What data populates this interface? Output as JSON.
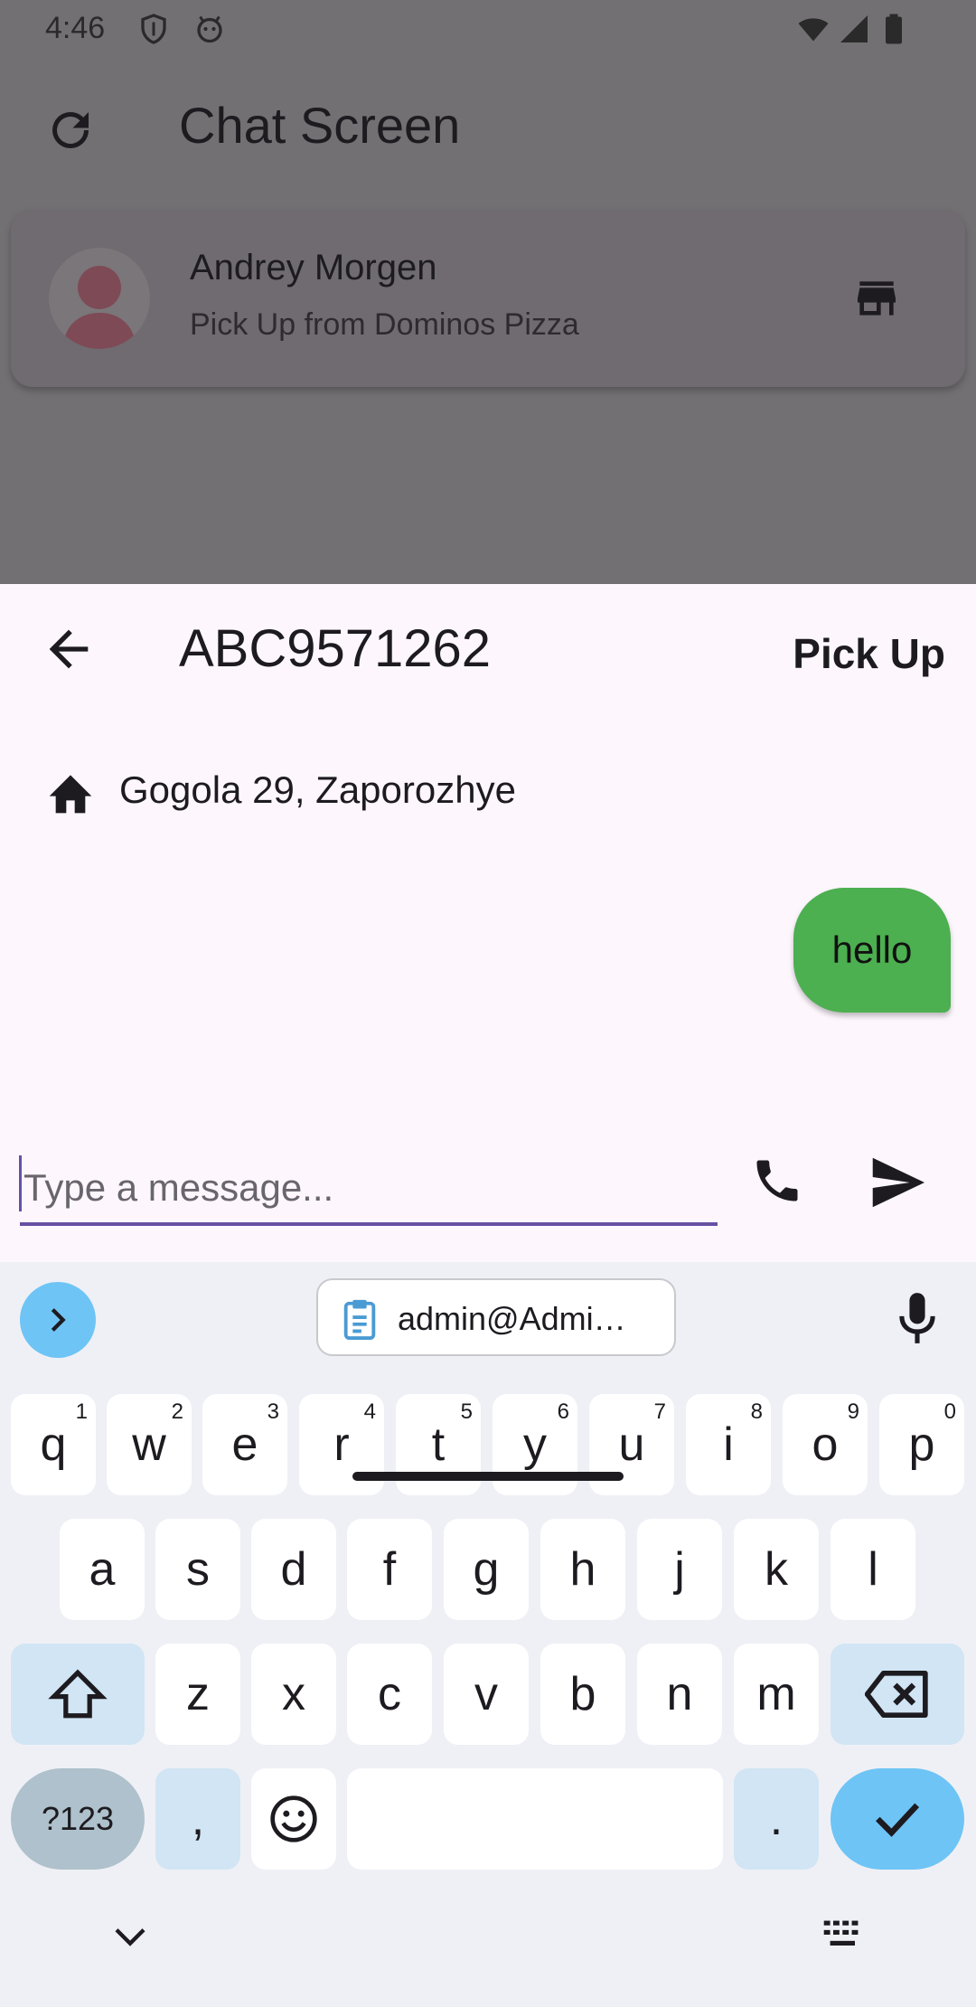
{
  "status_bar": {
    "time": "4:46"
  },
  "background_app": {
    "title": "Chat Screen",
    "card": {
      "name": "Andrey Morgen",
      "subtitle": "Pick Up from Dominos Pizza"
    }
  },
  "sheet": {
    "order_id": "ABC9571262",
    "pickup_label": "Pick Up",
    "address": "Gogola 29, Zaporozhye",
    "messages": [
      {
        "text": "hello",
        "sender": "me"
      }
    ],
    "input": {
      "placeholder": "Type a message...",
      "value": ""
    }
  },
  "keyboard": {
    "clipboard_chip": "admin@Admi…",
    "row1": [
      {
        "key": "q",
        "hint": "1"
      },
      {
        "key": "w",
        "hint": "2"
      },
      {
        "key": "e",
        "hint": "3"
      },
      {
        "key": "r",
        "hint": "4"
      },
      {
        "key": "t",
        "hint": "5"
      },
      {
        "key": "y",
        "hint": "6"
      },
      {
        "key": "u",
        "hint": "7"
      },
      {
        "key": "i",
        "hint": "8"
      },
      {
        "key": "o",
        "hint": "9"
      },
      {
        "key": "p",
        "hint": "0"
      }
    ],
    "row2": [
      "a",
      "s",
      "d",
      "f",
      "g",
      "h",
      "j",
      "k",
      "l"
    ],
    "row3": [
      "z",
      "x",
      "c",
      "v",
      "b",
      "n",
      "m"
    ],
    "symbols_key": "?123",
    "comma_key": ",",
    "period_key": "."
  },
  "colors": {
    "accent": "#6750a4",
    "bubble": "#4caf50",
    "sheet_bg": "#fdf7fd",
    "scrim": "#737074",
    "key_action": "#6ec4f5"
  }
}
